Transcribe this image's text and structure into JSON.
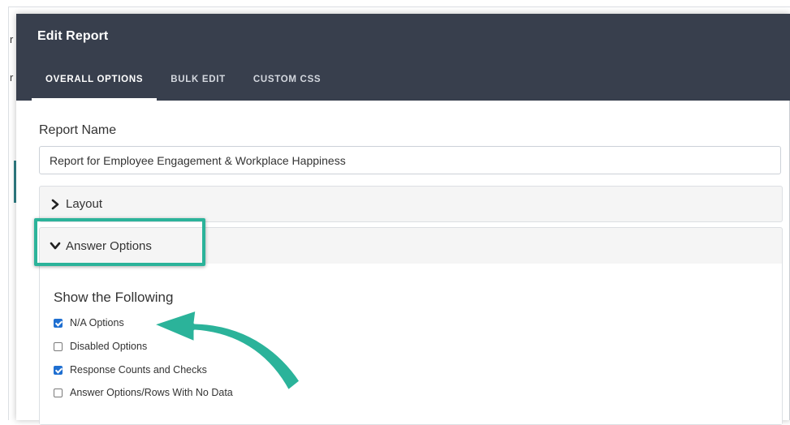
{
  "background": {
    "glyph_top": "r",
    "glyph_mid": "r"
  },
  "modal": {
    "title": "Edit Report",
    "tabs": [
      {
        "label": "OVERALL OPTIONS",
        "active": true
      },
      {
        "label": "BULK EDIT",
        "active": false
      },
      {
        "label": "CUSTOM CSS",
        "active": false
      }
    ]
  },
  "report_name": {
    "label": "Report Name",
    "value": "Report for Employee Engagement & Workplace Happiness"
  },
  "panels": {
    "layout": {
      "label": "Layout",
      "expanded": false
    },
    "answer_options": {
      "label": "Answer Options",
      "expanded": true,
      "section_title": "Show the Following",
      "options": [
        {
          "label": "N/A Options",
          "checked": true
        },
        {
          "label": "Disabled Options",
          "checked": false
        },
        {
          "label": "Response Counts and Checks",
          "checked": true
        },
        {
          "label": "Answer Options/Rows With No Data",
          "checked": false
        }
      ]
    }
  },
  "annotation": {
    "highlight_color": "#2bb39a",
    "arrow_color": "#2bb39a"
  },
  "colors": {
    "header_bg": "#383f4d",
    "checkbox_checked": "#1f6fd1"
  }
}
